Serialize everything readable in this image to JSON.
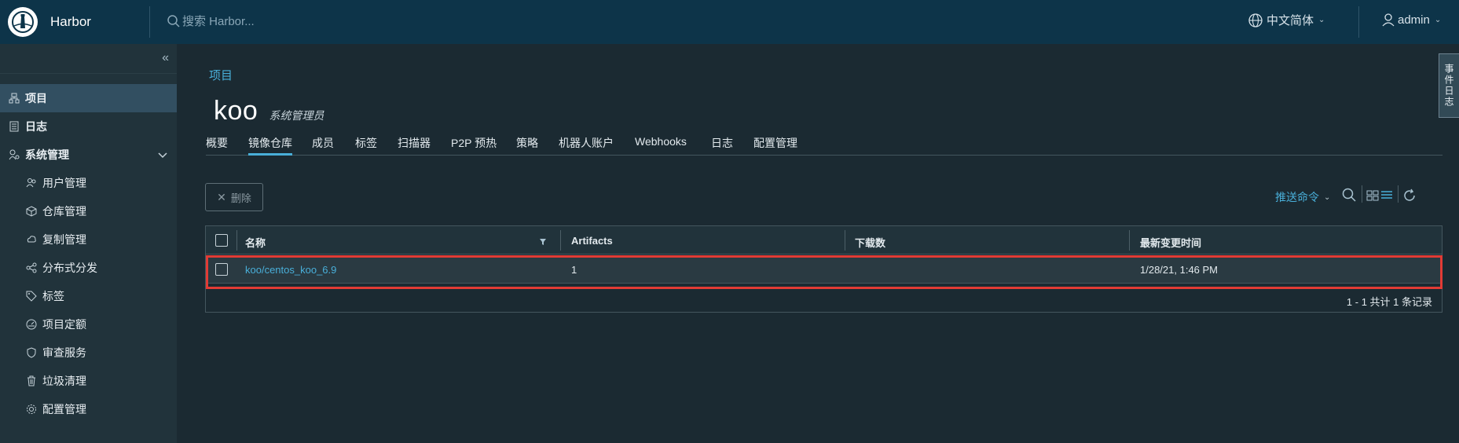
{
  "header": {
    "brand": "Harbor",
    "search_placeholder": "搜索 Harbor...",
    "language": "中文简体",
    "user": "admin"
  },
  "sidebar": {
    "items": [
      {
        "label": "项目",
        "icon": "projects-icon"
      },
      {
        "label": "日志",
        "icon": "logs-icon"
      },
      {
        "label": "系统管理",
        "icon": "system-admin-icon"
      },
      {
        "label": "用户管理",
        "icon": "users-icon"
      },
      {
        "label": "仓库管理",
        "icon": "registry-icon"
      },
      {
        "label": "复制管理",
        "icon": "replication-icon"
      },
      {
        "label": "分布式分发",
        "icon": "distribution-icon"
      },
      {
        "label": "标签",
        "icon": "tag-icon"
      },
      {
        "label": "项目定额",
        "icon": "quota-icon"
      },
      {
        "label": "审查服务",
        "icon": "shield-icon"
      },
      {
        "label": "垃圾清理",
        "icon": "trash-icon"
      },
      {
        "label": "配置管理",
        "icon": "gear-icon"
      }
    ]
  },
  "breadcrumb": "项目",
  "project": {
    "name": "koo",
    "role": "系统管理员"
  },
  "tabs": [
    "概要",
    "镜像仓库",
    "成员",
    "标签",
    "扫描器",
    "P2P 预热",
    "策略",
    "机器人账户",
    "Webhooks",
    "日志",
    "配置管理"
  ],
  "active_tab": "镜像仓库",
  "toolbar": {
    "delete": "删除",
    "push_command": "推送命令"
  },
  "table": {
    "columns": [
      "名称",
      "Artifacts",
      "下载数",
      "最新变更时间"
    ],
    "rows": [
      {
        "name": "koo/centos_koo_6.9",
        "artifacts": "1",
        "pulls": "",
        "updated": "1/28/21, 1:46 PM"
      }
    ],
    "footer": "1 - 1 共计 1 条记录"
  },
  "side_tab": "事件日志",
  "colors": {
    "header_bg": "#0d3449",
    "accent": "#49afd9",
    "highlight": "#e23b35"
  }
}
